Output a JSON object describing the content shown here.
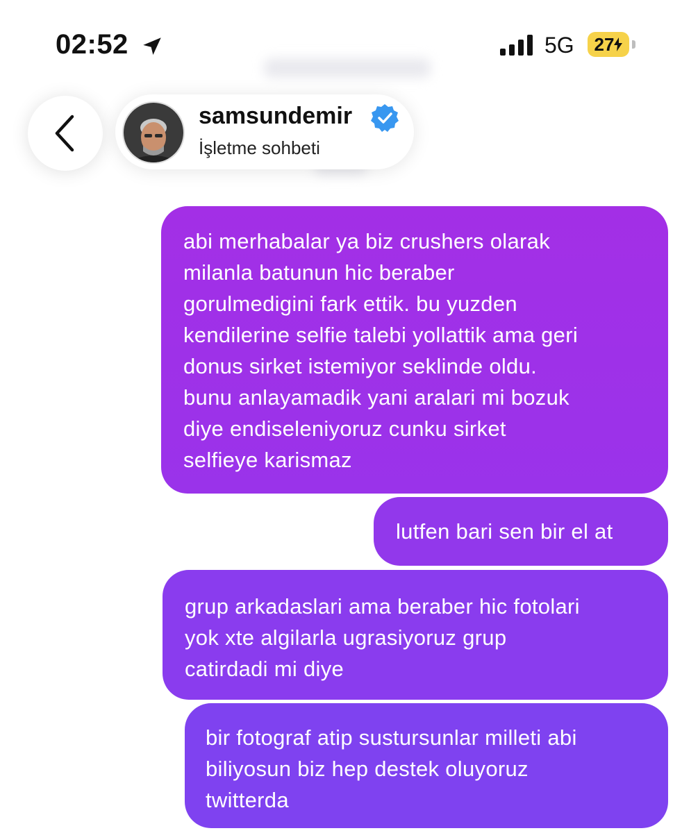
{
  "status_bar": {
    "time": "02:52",
    "network": "5G",
    "battery": "27"
  },
  "header": {
    "username": "samsundemir",
    "subtitle": "İşletme sohbeti"
  },
  "messages": [
    {
      "text": "abi merhabalar ya biz crushers olarak\nmilanla batunun hic beraber\ngorulmedigini fark ettik. bu yuzden\nkendilerine selfie talebi yollattik ama geri\ndonus sirket istemiyor seklinde oldu.\nbunu anlayamadik yani aralari mi bozuk\ndiye endiseleniyoruz cunku sirket\nselfieye karismaz"
    },
    {
      "text": "lutfen bari sen bir el at"
    },
    {
      "text": "grup arkadaslari ama beraber hic fotolari\nyok xte algilarla ugrasiyoruz grup\ncatirdadi mi diye"
    },
    {
      "text": "bir fotograf atip sustursunlar milleti abi\nbiliyosun biz hep destek oluyoruz\ntwitterda"
    }
  ],
  "colors": {
    "bubble_top": "#a32fe6",
    "bubble_bottom": "#7f42f0",
    "verified": "#3897f0",
    "battery": "#f6d24a"
  },
  "icons": [
    "location-arrow-icon",
    "signal-icon",
    "charging-icon",
    "chevron-left-icon",
    "verified-badge-icon"
  ]
}
